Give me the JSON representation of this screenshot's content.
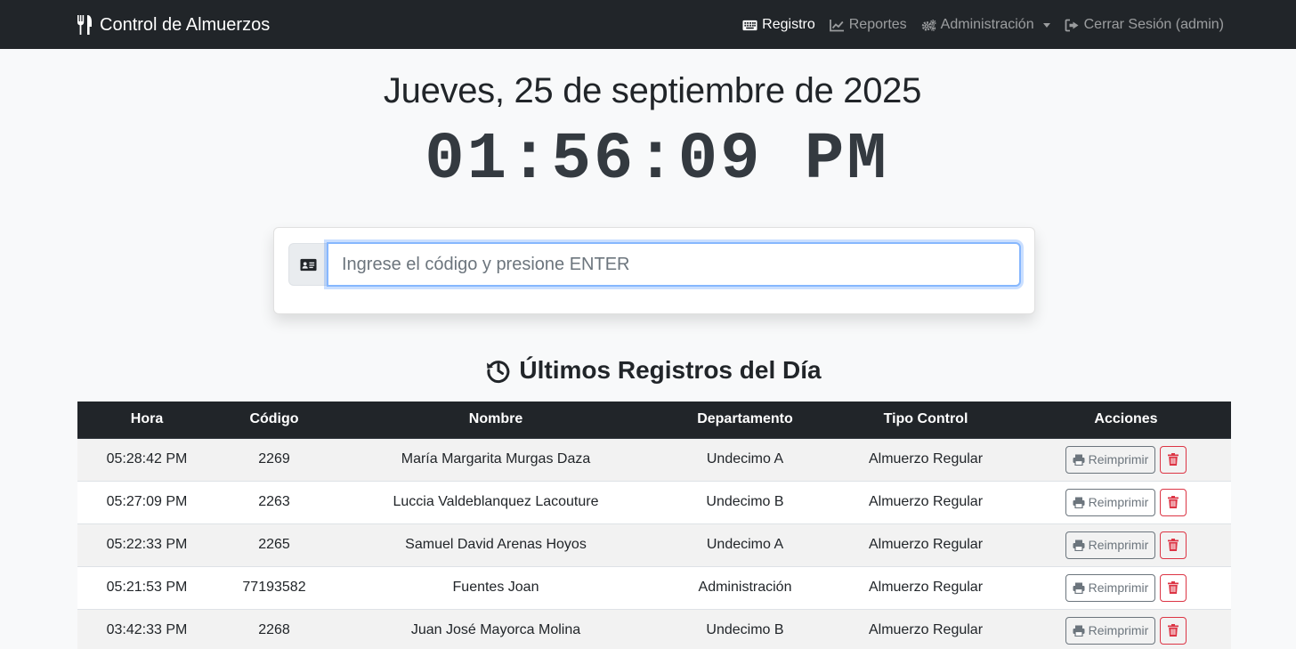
{
  "navbar": {
    "brand": "Control de Almuerzos",
    "items": [
      {
        "label": "Registro",
        "icon": "keyboard-icon",
        "active": true
      },
      {
        "label": "Reportes",
        "icon": "chart-line-icon",
        "active": false
      },
      {
        "label": "Administración",
        "icon": "gears-icon",
        "active": false
      },
      {
        "label": "Cerrar Sesión (admin)",
        "icon": "sign-out-icon",
        "active": false
      }
    ]
  },
  "clock": {
    "date": "Jueves, 25 de septiembre de 2025",
    "time": "01:56:09 PM"
  },
  "scan": {
    "placeholder": "Ingrese el código y presione ENTER",
    "value": "",
    "icon": "id-card-icon"
  },
  "records": {
    "title": "Últimos Registros del Día",
    "icon": "history-icon",
    "columns": [
      "Hora",
      "Código",
      "Nombre",
      "Departamento",
      "Tipo Control",
      "Acciones"
    ],
    "reprint_label": "Reimprimir",
    "rows": [
      {
        "hora": "05:28:42 PM",
        "codigo": "2269",
        "nombre": "María Margarita Murgas Daza",
        "departamento": "Undecimo A",
        "tipo": "Almuerzo Regular"
      },
      {
        "hora": "05:27:09 PM",
        "codigo": "2263",
        "nombre": "Luccia Valdeblanquez Lacouture",
        "departamento": "Undecimo B",
        "tipo": "Almuerzo Regular"
      },
      {
        "hora": "05:22:33 PM",
        "codigo": "2265",
        "nombre": "Samuel David Arenas Hoyos",
        "departamento": "Undecimo A",
        "tipo": "Almuerzo Regular"
      },
      {
        "hora": "05:21:53 PM",
        "codigo": "77193582",
        "nombre": "Fuentes Joan",
        "departamento": "Administración",
        "tipo": "Almuerzo Regular"
      },
      {
        "hora": "03:42:33 PM",
        "codigo": "2268",
        "nombre": "Juan José Mayorca Molina",
        "departamento": "Undecimo B",
        "tipo": "Almuerzo Regular"
      }
    ]
  },
  "colors": {
    "navbar": "#212529",
    "accent_focus": "#86b7fe",
    "danger": "#dc3545",
    "secondary": "#6c757d"
  }
}
